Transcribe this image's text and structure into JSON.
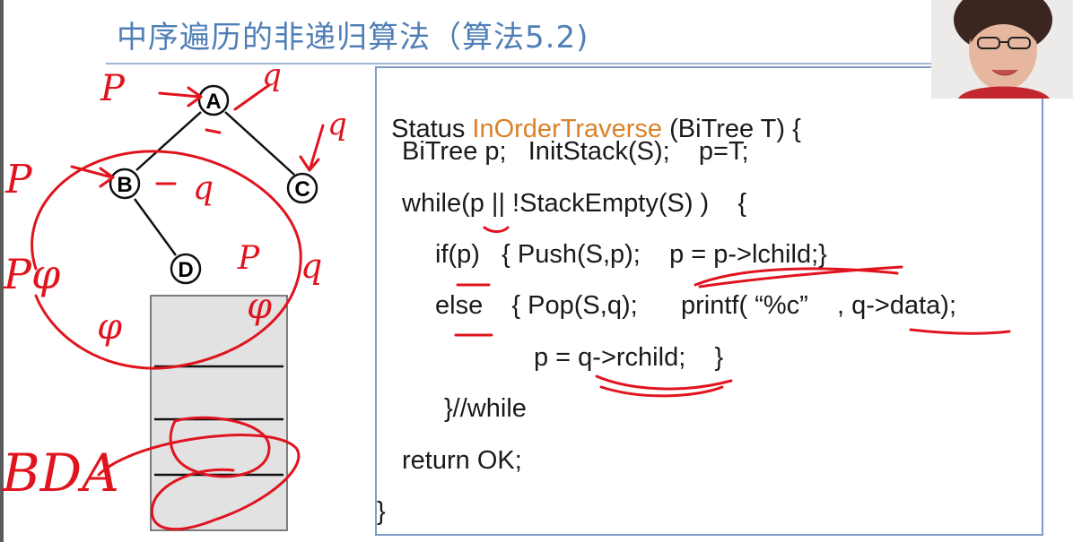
{
  "title": "中序遍历的非递归算法（算法5.2)",
  "code": {
    "line1_pre": "Status ",
    "line1_fn": "InOrderTraverse",
    "line1_post": " (BiTree T) {",
    "line2": "BiTree p;   InitStack(S);    p=T;",
    "line3": "while(p || !StackEmpty(S) )    {",
    "line4": "if(p)   { Push(S,p);    p = p->lchild;}",
    "line5": "else    { Pop(S,q);      printf( “%c”    , q->data);",
    "line6": "p = q->rchild;    }",
    "line7": "}//while",
    "line8": "return OK;",
    "line9": "}"
  },
  "tree": {
    "nodes": [
      "A",
      "B",
      "C",
      "D"
    ]
  },
  "handwriting": {
    "p_top": "P",
    "q_top": "q",
    "q_c": "q",
    "p_left": "P",
    "q_b": "q",
    "p_d": "P",
    "q_d": "q",
    "pphi": "Pφ",
    "phi_left": "φ",
    "phi_right": "φ",
    "output": "BDA"
  },
  "colors": {
    "title": "#4f7fb6",
    "accent": "#d9822b",
    "ink": "#e0141e",
    "border": "#7d9cc8"
  }
}
